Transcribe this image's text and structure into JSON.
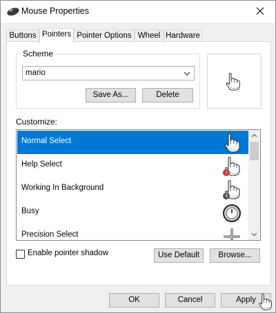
{
  "window": {
    "title": "Mouse Properties",
    "icon": "mouse-icon",
    "close_icon": "close-icon"
  },
  "tabs": [
    {
      "label": "Buttons",
      "active": false
    },
    {
      "label": "Pointers",
      "active": true
    },
    {
      "label": "Pointer Options",
      "active": false
    },
    {
      "label": "Wheel",
      "active": false
    },
    {
      "label": "Hardware",
      "active": false
    }
  ],
  "scheme": {
    "group_label": "Scheme",
    "selected": "mario",
    "save_as_label": "Save As...",
    "delete_label": "Delete",
    "preview_icon": "hand-cursor-icon"
  },
  "customize": {
    "label": "Customize:",
    "items": [
      {
        "label": "Normal Select",
        "icon": "hand-cursor-icon",
        "selected": true
      },
      {
        "label": "Help Select",
        "icon": "hand-help-cursor-icon",
        "selected": false
      },
      {
        "label": "Working In Background",
        "icon": "hand-busy-cursor-icon",
        "selected": false
      },
      {
        "label": "Busy",
        "icon": "clock-icon",
        "selected": false
      },
      {
        "label": "Precision Select",
        "icon": "crosshair-icon",
        "selected": false
      }
    ]
  },
  "shadow": {
    "label": "Enable pointer shadow",
    "checked": false
  },
  "use_default_label": "Use Default",
  "browse_label": "Browse...",
  "footer": {
    "ok_label": "OK",
    "cancel_label": "Cancel",
    "apply_label": "Apply"
  },
  "colors": {
    "selection": "#0078d7",
    "window_bg": "#f0f0f0",
    "panel_bg": "#ffffff"
  }
}
